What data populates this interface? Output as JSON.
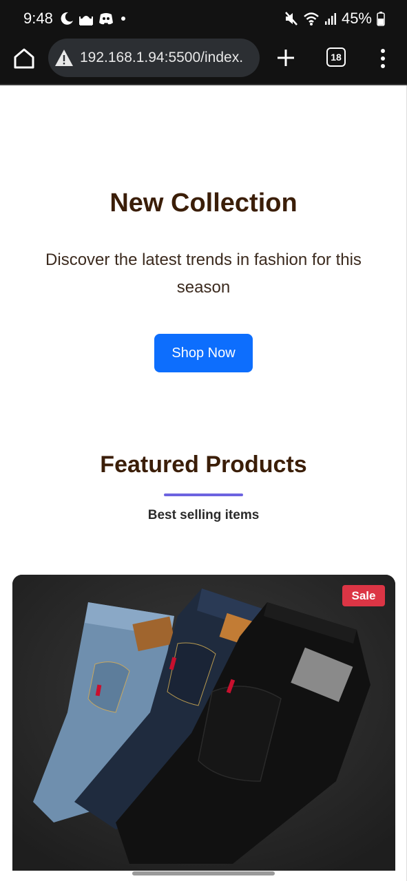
{
  "status_bar": {
    "time": "9:48",
    "battery": "45%",
    "icons": [
      "sleep-moon-icon",
      "mosque-icon",
      "discord-icon",
      "notification-dot",
      "mute-icon",
      "wifi-icon",
      "signal-icon",
      "battery-icon"
    ]
  },
  "browser": {
    "url": "192.168.1.94:5500/index.",
    "tab_count": "18",
    "icons": [
      "home-icon",
      "not-secure-warning-icon",
      "new-tab-plus-icon",
      "tabs-icon",
      "more-menu-icon"
    ]
  },
  "hero": {
    "title": "New Collection",
    "subtitle": "Discover the latest trends in fashion for this season",
    "button_label": "Shop Now"
  },
  "featured": {
    "title": "Featured Products",
    "subtitle": "Best selling items",
    "accent_color": "#6c63e0"
  },
  "product_card": {
    "badge": "Sale",
    "badge_color": "#dc3545",
    "image_subject": "folded jeans: light blue, dark blue, black"
  },
  "colors": {
    "primary_button": "#0d6efd",
    "heading": "#3b1e08",
    "browser_chrome": "#121212"
  }
}
